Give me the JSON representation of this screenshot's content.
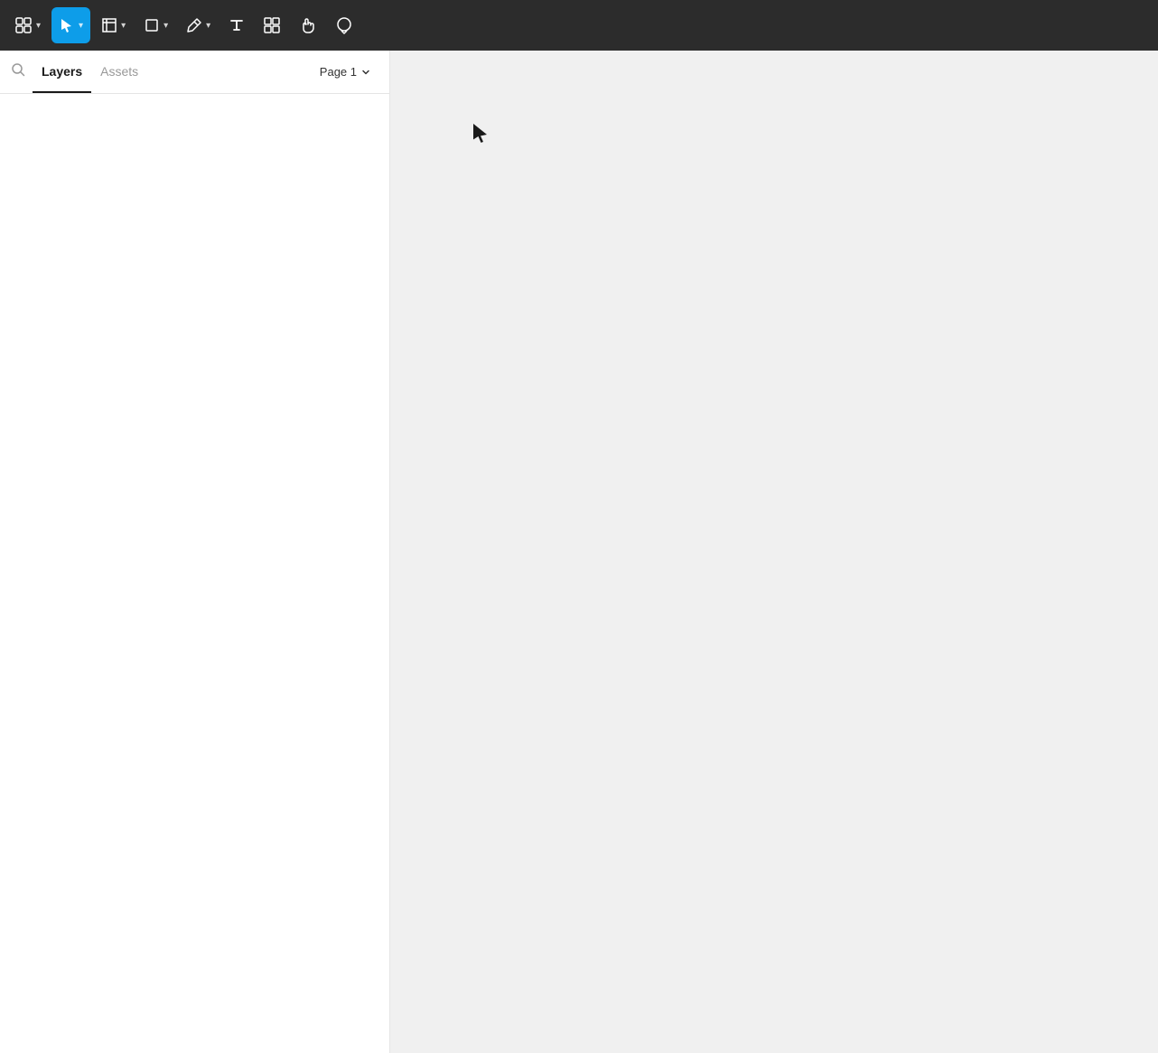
{
  "toolbar": {
    "logo_label": "⊞",
    "select_label": "▶",
    "frame_label": "⊞",
    "shape_label": "□",
    "pen_label": "✒",
    "text_label": "T",
    "components_label": "⊞",
    "hand_label": "✋",
    "comment_label": "◯",
    "active_tool": "select",
    "background_color": "#2c2c2c",
    "active_color": "#0d9de9"
  },
  "sidebar": {
    "search_icon": "🔍",
    "layers_tab": "Layers",
    "assets_tab": "Assets",
    "page_label": "Page 1"
  },
  "canvas": {
    "background_color": "#f0f0f0"
  }
}
